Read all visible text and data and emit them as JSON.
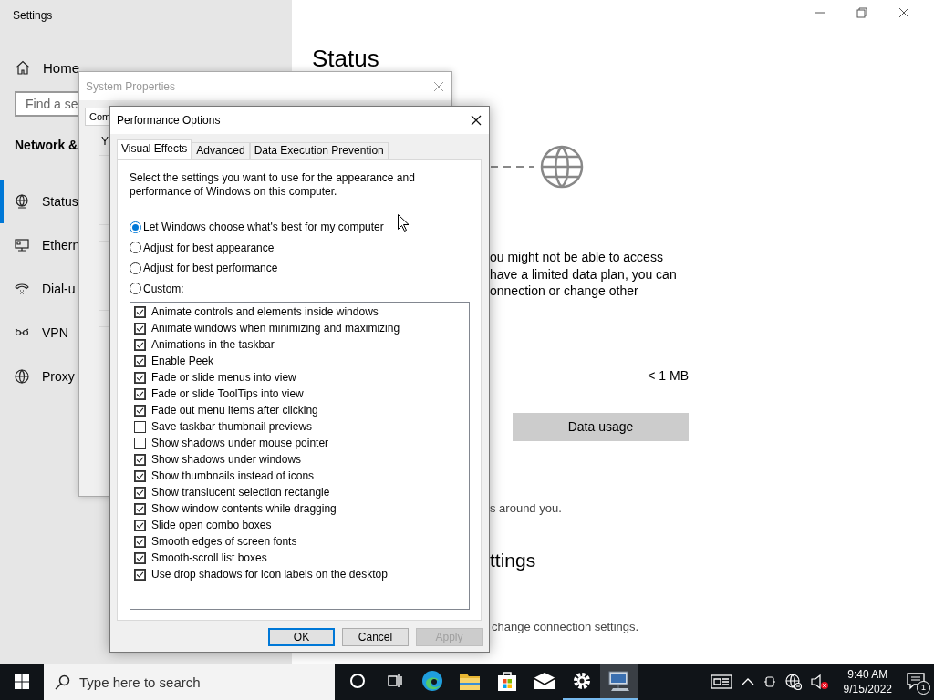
{
  "settings": {
    "title": "Settings",
    "home": "Home",
    "search": {
      "placeholder": "Find a se"
    },
    "section": "Network &",
    "nav": [
      {
        "label": "Status",
        "selected": true
      },
      {
        "label": "Ethern",
        "selected": false
      },
      {
        "label": "Dial-u",
        "selected": false
      },
      {
        "label": "VPN",
        "selected": false
      },
      {
        "label": "Proxy",
        "selected": false
      }
    ],
    "heading": "Status",
    "description": [
      "ou might not be able to access",
      "have a limited data plan, you can",
      "onnection or change other"
    ],
    "data_amount": "< 1 MB",
    "data_usage_button": "Data usage",
    "note": "s around you.",
    "heading_2": "ttings",
    "link_text": "change connection settings."
  },
  "system_properties": {
    "title": "System Properties",
    "tab": "Com",
    "text": "Y"
  },
  "performance_options": {
    "title": "Performance Options",
    "tabs": [
      {
        "label": "Visual Effects",
        "selected": true
      },
      {
        "label": "Advanced",
        "selected": false
      },
      {
        "label": "Data Execution Prevention",
        "selected": false
      }
    ],
    "description": "Select the settings you want to use for the appearance and performance of Windows on this computer.",
    "radios": [
      {
        "label": "Let Windows choose what's best for my computer",
        "selected": true
      },
      {
        "label": "Adjust for best appearance",
        "selected": false
      },
      {
        "label": "Adjust for best performance",
        "selected": false
      },
      {
        "label": "Custom:",
        "selected": false
      }
    ],
    "effects": [
      {
        "label": "Animate controls and elements inside windows",
        "checked": true
      },
      {
        "label": "Animate windows when minimizing and maximizing",
        "checked": true
      },
      {
        "label": "Animations in the taskbar",
        "checked": true
      },
      {
        "label": "Enable Peek",
        "checked": true
      },
      {
        "label": "Fade or slide menus into view",
        "checked": true
      },
      {
        "label": "Fade or slide ToolTips into view",
        "checked": true
      },
      {
        "label": "Fade out menu items after clicking",
        "checked": true
      },
      {
        "label": "Save taskbar thumbnail previews",
        "checked": false
      },
      {
        "label": "Show shadows under mouse pointer",
        "checked": false
      },
      {
        "label": "Show shadows under windows",
        "checked": true
      },
      {
        "label": "Show thumbnails instead of icons",
        "checked": true
      },
      {
        "label": "Show translucent selection rectangle",
        "checked": true
      },
      {
        "label": "Show window contents while dragging",
        "checked": true
      },
      {
        "label": "Slide open combo boxes",
        "checked": true
      },
      {
        "label": "Smooth edges of screen fonts",
        "checked": true
      },
      {
        "label": "Smooth-scroll list boxes",
        "checked": true
      },
      {
        "label": "Use drop shadows for icon labels on the desktop",
        "checked": true
      }
    ],
    "buttons": [
      {
        "label": "OK",
        "default": true,
        "disabled": false
      },
      {
        "label": "Cancel",
        "default": false,
        "disabled": false
      },
      {
        "label": "Apply",
        "default": false,
        "disabled": true
      }
    ]
  },
  "taskbar": {
    "search": {
      "placeholder": "Type here to search"
    },
    "apps": [
      {
        "running": false,
        "focused": false
      },
      {
        "running": false,
        "focused": false
      },
      {
        "running": false,
        "focused": false
      },
      {
        "running": false,
        "focused": false
      },
      {
        "running": false,
        "focused": false
      },
      {
        "running": false,
        "focused": false
      },
      {
        "running": true,
        "focused": false
      },
      {
        "running": true,
        "focused": true
      }
    ],
    "time": "9:40 AM",
    "date": "9/15/2022",
    "notification_count": "1"
  }
}
